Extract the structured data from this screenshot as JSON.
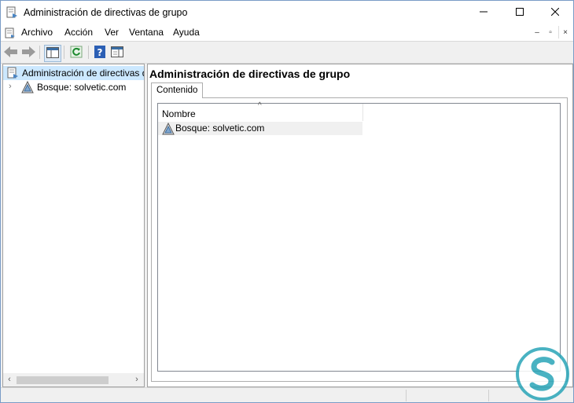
{
  "window": {
    "title": "Administración de directivas de grupo",
    "controls": {
      "minimize_icon": "minimize-icon",
      "maximize_icon": "maximize-icon",
      "close_icon": "close-icon"
    }
  },
  "menubar": {
    "items": [
      "Archivo",
      "Acción",
      "Ver",
      "Ventana",
      "Ayuda"
    ],
    "mdi_buttons": {
      "minimize": "–",
      "restore": "▫",
      "close": "×"
    }
  },
  "toolbar": {
    "buttons": [
      "back-arrow-icon",
      "forward-arrow-icon",
      "show-hide-tree-icon",
      "refresh-icon",
      "help-icon",
      "properties-icon"
    ]
  },
  "tree": {
    "root_label": "Administración de directivas de grupo",
    "children": [
      {
        "label": "Bosque: solvetic.com",
        "expander": "›"
      }
    ]
  },
  "content": {
    "title": "Administración de directivas de grupo",
    "tab_label": "Contenido",
    "column_header": "Nombre",
    "sort_indicator": "^",
    "rows": [
      {
        "name": "Bosque: solvetic.com"
      }
    ]
  },
  "scrollbar": {
    "left_arrow": "‹",
    "right_arrow": "›"
  },
  "colors": {
    "selection": "#cce8ff",
    "accent": "#0078d7",
    "watermark": "#2aa5b8"
  }
}
